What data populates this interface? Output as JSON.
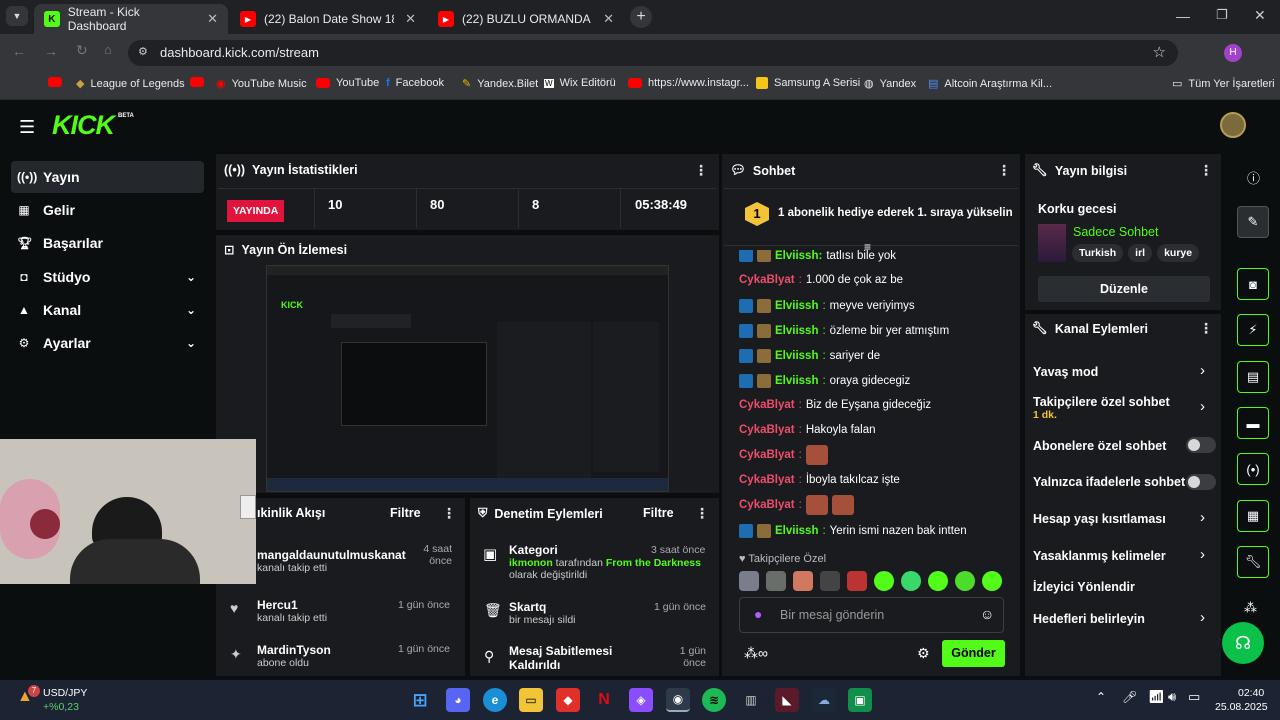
{
  "browser": {
    "tabs": [
      {
        "title": "Stream - Kick Dashboard",
        "active": true
      },
      {
        "title": "(22) Balon Date Show 18. Bölüm"
      },
      {
        "title": "(22) BUZLU ORMANDA KAMP"
      }
    ],
    "url": "dashboard.kick.com/stream",
    "profile_letter": "H",
    "bookmarks": [
      "League of Legends",
      "YouTube Music",
      "YouTube",
      "Facebook",
      "Yandex.Bilet",
      "Wix Editörü",
      "https://www.instagr...",
      "Samsung A Serisi",
      "Yandex",
      "Altcoin Araştırma Kil..."
    ],
    "all_bookmarks": "Tüm Yer İşaretleri"
  },
  "kick": {
    "logo": "KICK",
    "beta": "BETA",
    "nav": [
      {
        "label": "Yayın",
        "icon": "broadcast-icon",
        "active": true
      },
      {
        "label": "Gelir",
        "icon": "revenue-icon"
      },
      {
        "label": "Başarılar",
        "icon": "trophy-icon"
      },
      {
        "label": "Stüdyo",
        "icon": "studio-icon",
        "expandable": true
      },
      {
        "label": "Kanal",
        "icon": "channel-icon",
        "expandable": true
      },
      {
        "label": "Ayarlar",
        "icon": "settings-icon",
        "expandable": true
      }
    ],
    "stats": {
      "title": "Yayın İstatistikleri",
      "live_label": "YAYINDA",
      "viewers": "10",
      "followers": "80",
      "subs": "8",
      "uptime": "05:38:49"
    },
    "preview": {
      "title": "Yayın Ön İzlemesi"
    },
    "activity": {
      "title": "ıkinlik Akışı",
      "filter": "Filtre",
      "items": [
        {
          "name": "mangaldaunutulmuskanat",
          "sub": "kanalı takip etti",
          "time": "4 saat önce"
        },
        {
          "name": "Hercu1",
          "sub": "kanalı takip etti",
          "time": "1 gün önce"
        },
        {
          "name": "MardinTyson",
          "sub": "abone oldu",
          "time": "1 gün önce"
        }
      ]
    },
    "moderation": {
      "title": "Denetim Eylemleri",
      "filter": "Filtre",
      "items": [
        {
          "title": "Kategori",
          "user": "ikmonon",
          "mid": " tarafından ",
          "target": "From the Darkness",
          "rest": "olarak değiştirildi",
          "time": "3 saat önce"
        },
        {
          "title": "Skartq",
          "rest": "bir mesajı sildi",
          "time": "1 gün önce"
        },
        {
          "title": "Mesaj Sabitlemesi Kaldırıldı",
          "time": "1 gün önce"
        }
      ]
    },
    "chat": {
      "title": "Sohbet",
      "pinned_num": "1",
      "pinned": "1 abonelik hediye ederek 1. sıraya yükselin",
      "top_partial": "tatlısı bile yok",
      "messages": [
        {
          "user": "CykaBlyat",
          "text": "1.000 de çok az be",
          "color": "pink"
        },
        {
          "user": "Elviissh",
          "text": "meyve veriyimys",
          "color": "green"
        },
        {
          "user": "Elviissh",
          "text": "özleme bir yer atmıştım",
          "color": "green"
        },
        {
          "user": "Elviissh",
          "text": "sariyer de",
          "color": "green"
        },
        {
          "user": "Elviissh",
          "text": "oraya gidecegiz",
          "color": "green"
        },
        {
          "user": "CykaBlyat",
          "text": "Biz de Eyşana gideceğiz",
          "color": "pink"
        },
        {
          "user": "CykaBlyat",
          "text": "Hakoyla falan",
          "color": "pink"
        },
        {
          "user": "CykaBlyat",
          "text": "",
          "color": "pink"
        },
        {
          "user": "CykaBlyat",
          "text": "İboyla takılcaz işte",
          "color": "pink"
        },
        {
          "user": "CykaBlyat",
          "text": "",
          "color": "pink"
        },
        {
          "user": "Elviissh",
          "text": "Yerin ismi nazen bak intten",
          "color": "green"
        }
      ],
      "followers_only": "Takipçilere Özel",
      "placeholder": "Bir mesaj gönderin",
      "send": "Gönder"
    },
    "stream_info": {
      "title": "Yayın bilgisi",
      "stream_title": "Korku gecesi",
      "category": "Sadece Sohbet",
      "tags": [
        "Turkish",
        "irl",
        "kurye"
      ],
      "edit": "Düzenle"
    },
    "channel_actions": {
      "title": "Kanal Eylemleri",
      "slow_mode": "Yavaş mod",
      "followers_chat": "Takipçilere özel sohbet",
      "followers_chat_val": "1 dk.",
      "subs_chat": "Abonelere özel sohbet",
      "emotes_chat": "Yalnızca ifadelerle sohbet",
      "age_limit": "Hesap yaşı kısıtlaması",
      "banned_words": "Yasaklanmış kelimeler",
      "viewer_redirect": "İzleyici Yönlendir",
      "set_goals": "Hedefleri belirleyin"
    }
  },
  "taskbar": {
    "ticker": "USD/JPY",
    "change": "+%0,23",
    "badge": "7",
    "time": "02:40",
    "date": "25.08.2025"
  }
}
